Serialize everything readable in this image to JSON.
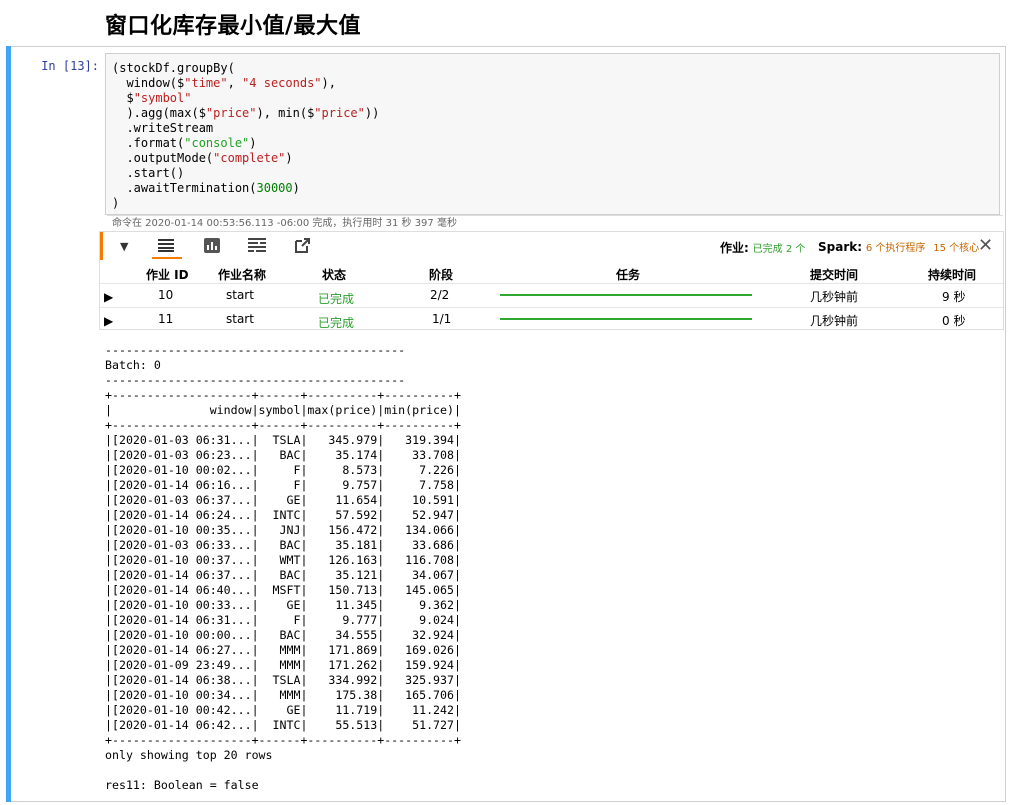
{
  "heading": "窗口化库存最小值/最大值",
  "cell": {
    "prompt": "In [13]:",
    "code": {
      "l1": "(stockDf.groupBy(",
      "l2_a": "  window($",
      "l2_s1": "\"time\"",
      "l2_b": ", ",
      "l2_s2": "\"4 seconds\"",
      "l2_c": "),",
      "l3_a": "  $",
      "l3_s": "\"symbol\"",
      "l4_a": "  ).agg(max($",
      "l4_s1": "\"price\"",
      "l4_b": "), min($",
      "l4_s2": "\"price\"",
      "l4_c": "))",
      "l5": "  .writeStream",
      "l6_a": "  .format(",
      "l6_s": "\"console\"",
      "l6_c": ")",
      "l7_a": "  .outputMode(",
      "l7_s": "\"complete\"",
      "l7_c": ")",
      "l8": "  .start()",
      "l9_a": "  .awaitTermination(",
      "l9_n": "30000",
      "l9_c": ")",
      "l10": ")"
    },
    "meta": "命令在 2020-01-14 00:53:56.113 -06:00 完成，执行用时 31 秒 397 毫秒"
  },
  "jobs": {
    "toolbar": {
      "collapse_icon": "triangle-down-icon",
      "table_icon": "table-icon",
      "chart_icon": "bar-chart-icon",
      "timeline_icon": "timeline-icon",
      "popout_icon": "external-link-icon"
    },
    "summary": {
      "jobs_label": "作业:",
      "jobs_value": "已完成 2 个",
      "spark_label": "Spark:",
      "spark_executors": "6 个执行程序",
      "spark_cores": "15 个核心"
    },
    "headers": [
      "作业 ID",
      "作业名称",
      "状态",
      "阶段",
      "任务",
      "提交时间",
      "持续时间"
    ],
    "rows": [
      {
        "id": "10",
        "name": "start",
        "status": "已完成",
        "stages": "2/2",
        "progress": 1.0,
        "submitted": "几秒钟前",
        "duration": "9 秒"
      },
      {
        "id": "11",
        "name": "start",
        "status": "已完成",
        "stages": "1/1",
        "progress": 1.0,
        "submitted": "几秒钟前",
        "duration": "0 秒"
      }
    ],
    "colors": {
      "accent": "#f57c00",
      "progress": "#2ea82e",
      "status": "#2e9e2e",
      "executors": "#c56500"
    }
  },
  "output": {
    "lines": [
      "-------------------------------------------",
      "Batch: 0",
      "-------------------------------------------",
      "+--------------------+------+----------+----------+",
      "|              window|symbol|max(price)|min(price)|",
      "+--------------------+------+----------+----------+",
      "|[2020-01-03 06:31...|  TSLA|   345.979|   319.394|",
      "|[2020-01-03 06:23...|   BAC|    35.174|    33.708|",
      "|[2020-01-10 00:02...|     F|     8.573|     7.226|",
      "|[2020-01-14 06:16...|     F|     9.757|     7.758|",
      "|[2020-01-03 06:37...|    GE|    11.654|    10.591|",
      "|[2020-01-14 06:24...|  INTC|    57.592|    52.947|",
      "|[2020-01-10 00:35...|   JNJ|   156.472|   134.066|",
      "|[2020-01-03 06:33...|   BAC|    35.181|    33.686|",
      "|[2020-01-10 00:37...|   WMT|   126.163|   116.708|",
      "|[2020-01-14 06:37...|   BAC|    35.121|    34.067|",
      "|[2020-01-14 06:40...|  MSFT|   150.713|   145.065|",
      "|[2020-01-10 00:33...|    GE|    11.345|     9.362|",
      "|[2020-01-14 06:31...|     F|     9.777|     9.024|",
      "|[2020-01-10 00:00...|   BAC|    34.555|    32.924|",
      "|[2020-01-14 06:27...|   MMM|   171.869|   169.026|",
      "|[2020-01-09 23:49...|   MMM|   171.262|   159.924|",
      "|[2020-01-14 06:38...|  TSLA|   334.992|   325.937|",
      "|[2020-01-10 00:34...|   MMM|    175.38|   165.706|",
      "|[2020-01-10 00:42...|    GE|    11.719|    11.242|",
      "|[2020-01-14 06:42...|  INTC|    55.513|    51.727|",
      "+--------------------+------+----------+----------+",
      "only showing top 20 rows",
      "",
      "res11: Boolean = false"
    ]
  }
}
